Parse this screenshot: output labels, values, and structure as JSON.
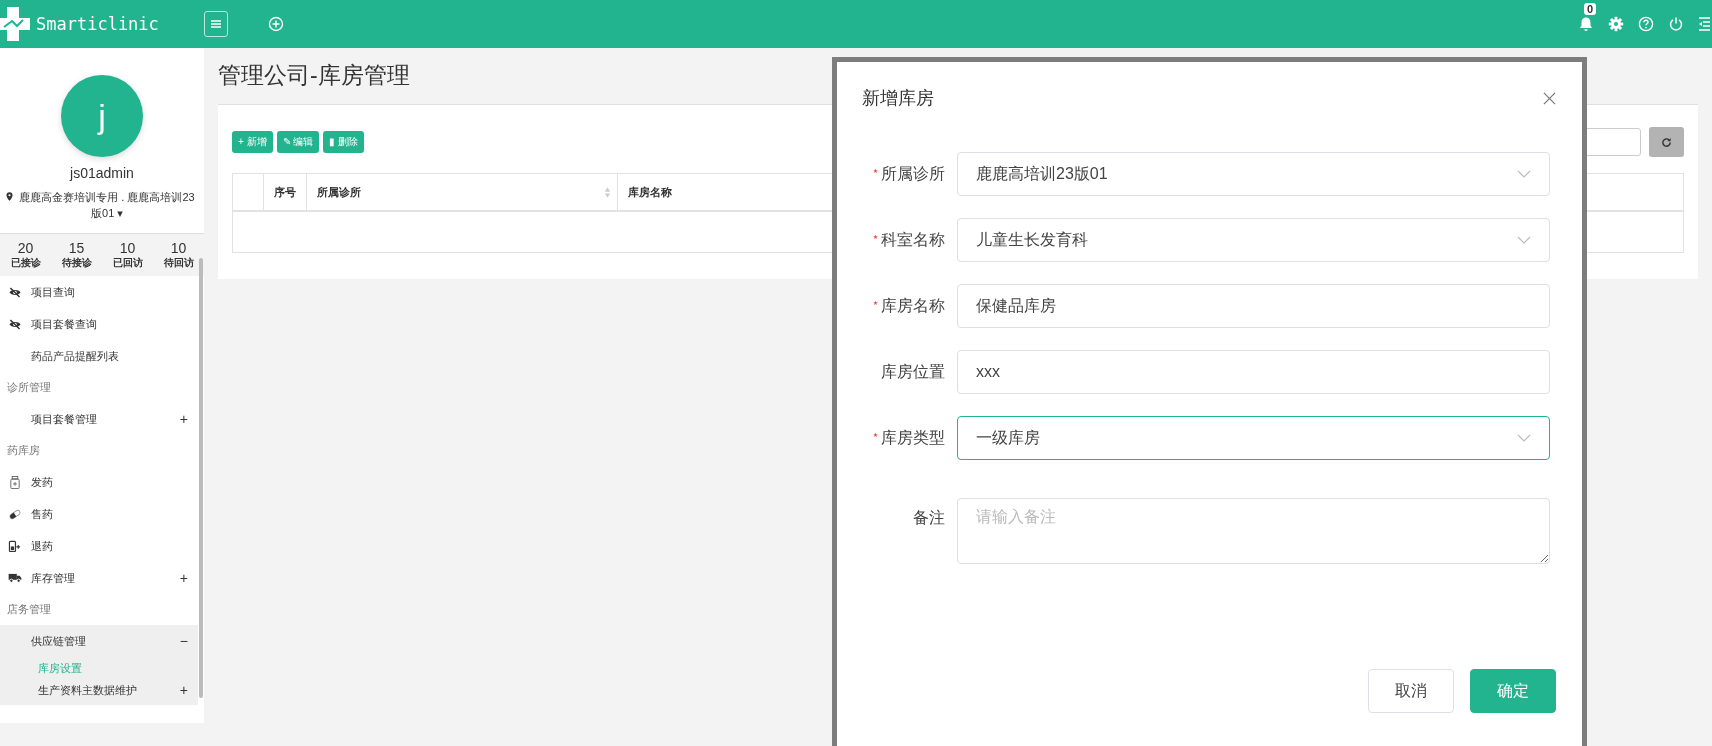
{
  "header": {
    "brand": "Smarticlinic",
    "notification_count": "0"
  },
  "user": {
    "avatar_letter": "j",
    "name": "js01admin",
    "location": "鹿鹿高金赛培训专用 . 鹿鹿高培训23版01",
    "caret": "▾"
  },
  "stats": [
    {
      "value": "20",
      "label": "已接诊"
    },
    {
      "value": "15",
      "label": "待接诊"
    },
    {
      "value": "10",
      "label": "已回访"
    },
    {
      "value": "10",
      "label": "待回访"
    }
  ],
  "sidebar": {
    "items": [
      {
        "kind": "item",
        "label": "项目查询"
      },
      {
        "kind": "item",
        "label": "项目套餐查询"
      },
      {
        "kind": "item",
        "label": "药品产品提醒列表"
      },
      {
        "kind": "section",
        "label": "诊所管理"
      },
      {
        "kind": "item",
        "label": "项目套餐管理",
        "toggle": "+",
        "expanded": false
      },
      {
        "kind": "section",
        "label": "药库房"
      },
      {
        "kind": "item",
        "label": "发药"
      },
      {
        "kind": "item",
        "label": "售药"
      },
      {
        "kind": "item",
        "label": "退药"
      },
      {
        "kind": "item",
        "label": "库存管理",
        "toggle": "+",
        "expanded": false
      },
      {
        "kind": "section",
        "label": "店务管理"
      },
      {
        "kind": "item",
        "label": "供应链管理",
        "toggle": "−",
        "expanded": true,
        "children": [
          {
            "label": "库房设置",
            "selected": true
          },
          {
            "label": "生产资料主数据维护",
            "selected": false,
            "toggle": "+"
          }
        ]
      }
    ]
  },
  "page": {
    "title": "管理公司-库房管理"
  },
  "toolbar": [
    {
      "symbol": "+",
      "label": "新增"
    },
    {
      "symbol": "✎",
      "label": "编辑"
    },
    {
      "symbol": "▮",
      "label": "删除"
    }
  ],
  "table": {
    "columns": [
      {
        "label": "序号",
        "sortable": false
      },
      {
        "label": "所属诊所",
        "sortable": true
      },
      {
        "label": "库房名称",
        "sortable": false
      }
    ]
  },
  "dialog": {
    "title": "新增库房",
    "fields": [
      {
        "kind": "select",
        "label": "所属诊所",
        "required": true,
        "focused": false,
        "value": "鹿鹿高培训23版01"
      },
      {
        "kind": "select",
        "label": "科室名称",
        "required": true,
        "focused": false,
        "value": "儿童生长发育科"
      },
      {
        "kind": "input",
        "label": "库房名称",
        "required": true,
        "focused": false,
        "value": "保健品库房"
      },
      {
        "kind": "input",
        "label": "库房位置",
        "required": false,
        "focused": false,
        "value": "xxx"
      },
      {
        "kind": "select",
        "label": "库房类型",
        "required": true,
        "focused": true,
        "value": "一级库房"
      },
      {
        "kind": "textarea",
        "label": "备注",
        "required": false,
        "focused": false,
        "placeholder": "请输入备注"
      }
    ],
    "buttons": [
      {
        "kind": "secondary",
        "label": "取消"
      },
      {
        "kind": "primary",
        "label": "确定"
      }
    ]
  }
}
